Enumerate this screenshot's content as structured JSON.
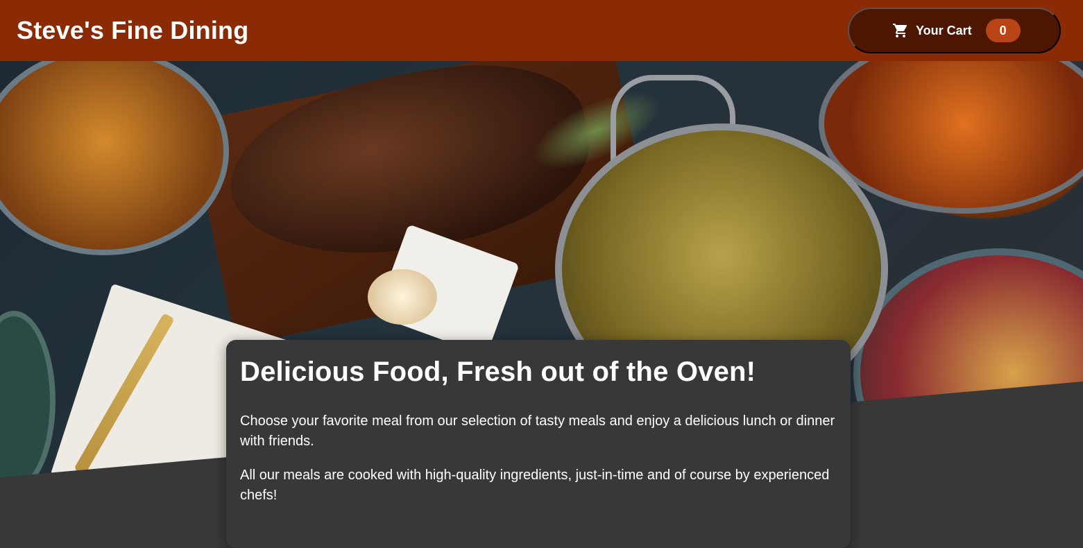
{
  "header": {
    "title": "Steve's Fine Dining",
    "cart": {
      "icon": "cart-icon",
      "label": "Your Cart",
      "count": "0"
    }
  },
  "colors": {
    "header_bg": "#8a2b06",
    "cart_bg": "#4d1601",
    "badge_bg": "#b94517",
    "page_bg": "#383838",
    "text": "#ffffff"
  },
  "hero": {
    "image": "food-banner-image"
  },
  "summary": {
    "title": "Delicious Food, Fresh out of the Oven!",
    "paragraphs": [
      "Choose your favorite meal from our selection of tasty meals and enjoy a delicious lunch or dinner with friends.",
      "All our meals are cooked with high-quality ingredients, just-in-time and of course by experienced chefs!"
    ]
  }
}
